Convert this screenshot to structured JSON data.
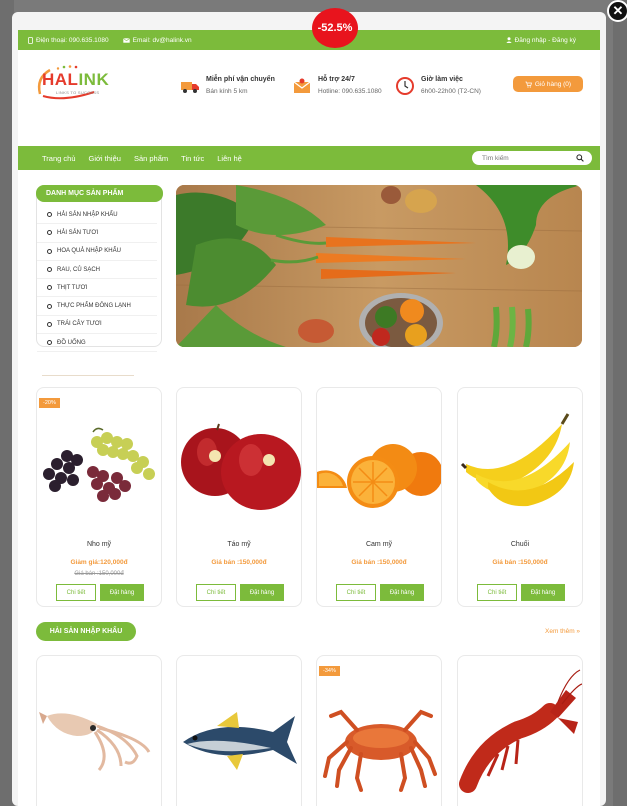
{
  "modal": {
    "close_label": "✕",
    "discount_badge": "-52.5%"
  },
  "topbar": {
    "phone": "Điện thoại: 090.635.1080",
    "email": "Email: dv@halink.vn",
    "account": "Đăng nhập - Đăng ký"
  },
  "logo": {
    "brand_red": "HAL",
    "brand_green": "INK",
    "slogan": "LINKS TO SUCCESS"
  },
  "features": [
    {
      "title": "Miễn phí vận chuyển",
      "subtitle": "Bán kính 5 km",
      "icon": "truck-icon"
    },
    {
      "title": "Hỗ trợ 24/7",
      "subtitle": "Hotline: 090.635.1080",
      "icon": "mail-icon"
    },
    {
      "title": "Giờ làm việc",
      "subtitle": "6h00-22h00 (T2-CN)",
      "icon": "clock-icon"
    }
  ],
  "cart": {
    "label": "Giỏ hàng (0)",
    "icon": "cart-icon"
  },
  "nav": {
    "items": [
      "Trang chủ",
      "Giới thiệu",
      "Sản phẩm",
      "Tin tức",
      "Liên hệ"
    ],
    "search_placeholder": "Tìm kiếm"
  },
  "sidebar": {
    "title": "DANH MỤC SẢN PHẨM",
    "categories": [
      "HẢI SẢN NHẬP KHẨU",
      "HẢI SẢN TƯƠI",
      "HOA QUẢ NHẬP KHẨU",
      "RAU, CỦ SẠCH",
      "THỊT TƯƠI",
      "THỰC PHẨM ĐÔNG LẠNH",
      "TRÁI CÂY TƯƠI",
      "ĐỒ UỐNG"
    ]
  },
  "products": [
    {
      "name": "Nho mỹ",
      "price": "Giảm giá:120,000đ",
      "old_price": "Giá bán :150,000đ",
      "sale": "-20%"
    },
    {
      "name": "Táo mỹ",
      "price": "Giá bán :150,000đ"
    },
    {
      "name": "Cam mỹ",
      "price": "Giá bán :150,000đ"
    },
    {
      "name": "Chuối",
      "price": "Giá bán :150,000đ"
    }
  ],
  "buttons": {
    "detail": "Chi tiết",
    "order": "Đặt hàng"
  },
  "section2": {
    "title": "HẢI SẢN NHẬP KHẨU",
    "see_more": "Xem thêm »",
    "sale_tag": "-34%"
  },
  "colors": {
    "green": "#7cbb3b",
    "orange": "#f39a3c",
    "red": "#e8141d"
  }
}
